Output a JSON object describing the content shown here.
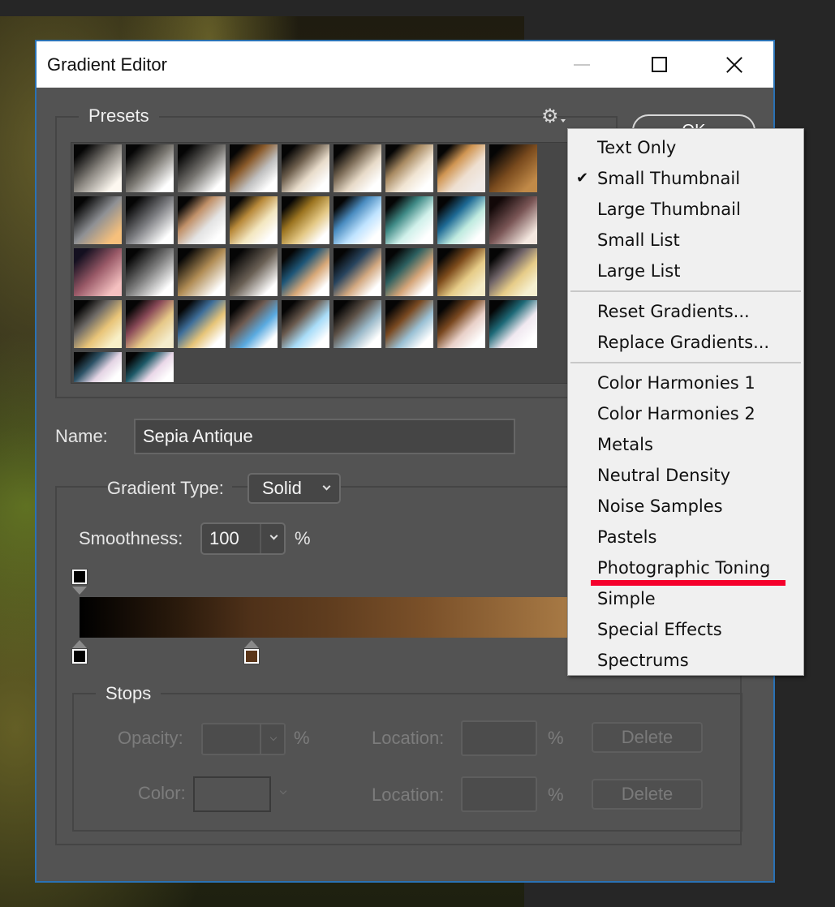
{
  "window": {
    "title": "Gradient Editor",
    "controls": {
      "minimize": "minimize",
      "maximize": "maximize",
      "close": "close"
    }
  },
  "presets": {
    "label": "Presets",
    "settings_icon": "gear-icon",
    "thumbnails": [
      {
        "name": "preset-1",
        "colors": [
          "#050505",
          "#8a8680",
          "#fdf8f0"
        ]
      },
      {
        "name": "preset-2",
        "colors": [
          "#050505",
          "#7d7a74",
          "#ffffff"
        ]
      },
      {
        "name": "preset-3",
        "colors": [
          "#050505",
          "#75736f",
          "#ffffff"
        ]
      },
      {
        "name": "preset-4",
        "colors": [
          "#050505",
          "#8a5a2a",
          "#bfbfbf",
          "#ffffff"
        ]
      },
      {
        "name": "preset-5",
        "colors": [
          "#050505",
          "#6e5f4d",
          "#e8dccb",
          "#ffffff"
        ]
      },
      {
        "name": "preset-6",
        "colors": [
          "#050505",
          "#7a6a55",
          "#e7dac8",
          "#ffffff"
        ]
      },
      {
        "name": "preset-7",
        "colors": [
          "#050505",
          "#a88a62",
          "#f0e4d2",
          "#ffffff"
        ]
      },
      {
        "name": "preset-8",
        "colors": [
          "#050505",
          "#d09552",
          "#eedfd0",
          "#f0ebe8"
        ]
      },
      {
        "name": "preset-9",
        "colors": [
          "#050505",
          "#7a4b1e",
          "#c18a48"
        ]
      },
      {
        "name": "preset-10",
        "colors": [
          "#050505",
          "#8e9094",
          "#f6c07c"
        ]
      },
      {
        "name": "preset-11",
        "colors": [
          "#050505",
          "#7b7c80",
          "#ffffff"
        ]
      },
      {
        "name": "preset-12",
        "colors": [
          "#050505",
          "#c09068",
          "#e3e3e3",
          "#ffffff"
        ]
      },
      {
        "name": "preset-13",
        "colors": [
          "#050505",
          "#b8893a",
          "#f3e6bf",
          "#ffffff"
        ]
      },
      {
        "name": "preset-14",
        "colors": [
          "#050505",
          "#9b7420",
          "#e3c784",
          "#ffffff"
        ]
      },
      {
        "name": "preset-15",
        "colors": [
          "#050505",
          "#4a8cc0",
          "#bfe3ff",
          "#ffffff"
        ]
      },
      {
        "name": "preset-16",
        "colors": [
          "#050505",
          "#3f8a86",
          "#d0f0ea",
          "#ffffff"
        ]
      },
      {
        "name": "preset-17",
        "colors": [
          "#050505",
          "#1e6a95",
          "#bfeadf",
          "#ffffff"
        ]
      },
      {
        "name": "preset-18",
        "colors": [
          "#120808",
          "#7a5656",
          "#f4e8e0"
        ]
      },
      {
        "name": "preset-19",
        "colors": [
          "#141020",
          "#9a5a68",
          "#f4c0c0"
        ]
      },
      {
        "name": "preset-20",
        "colors": [
          "#050505",
          "#7c7c7c",
          "#ffffff"
        ]
      },
      {
        "name": "preset-21",
        "colors": [
          "#050505",
          "#b08c55",
          "#ffffff"
        ]
      },
      {
        "name": "preset-22",
        "colors": [
          "#050505",
          "#6a6055",
          "#ffffff"
        ]
      },
      {
        "name": "preset-23",
        "colors": [
          "#050505",
          "#1e5678",
          "#d8a878",
          "#ffffff"
        ]
      },
      {
        "name": "preset-24",
        "colors": [
          "#050505",
          "#28445e",
          "#d2a880",
          "#ffffff"
        ]
      },
      {
        "name": "preset-25",
        "colors": [
          "#050505",
          "#2d6060",
          "#d4a478",
          "#ffffff"
        ]
      },
      {
        "name": "preset-26",
        "colors": [
          "#050505",
          "#7e4c1c",
          "#e6cc88",
          "#f4ecc8"
        ]
      },
      {
        "name": "preset-27",
        "colors": [
          "#050505",
          "#706468",
          "#e6cc88",
          "#f6f0d0"
        ]
      },
      {
        "name": "preset-28",
        "colors": [
          "#050505",
          "#6e6a66",
          "#e8c478",
          "#f8f0c8"
        ]
      },
      {
        "name": "preset-29",
        "colors": [
          "#050505",
          "#8a4a58",
          "#e6c888",
          "#f4eccc"
        ]
      },
      {
        "name": "preset-30",
        "colors": [
          "#050505",
          "#3e6e9a",
          "#e6c478",
          "#ffffff"
        ]
      },
      {
        "name": "preset-31",
        "colors": [
          "#050505",
          "#6e5a50",
          "#5aaae0",
          "#ffffff"
        ]
      },
      {
        "name": "preset-32",
        "colors": [
          "#050505",
          "#6a5a4e",
          "#a8dcf8",
          "#ffffff"
        ]
      },
      {
        "name": "preset-33",
        "colors": [
          "#050505",
          "#5c5046",
          "#9ab8c8",
          "#ffffff"
        ]
      },
      {
        "name": "preset-34",
        "colors": [
          "#050505",
          "#7a4a22",
          "#9ac0d4",
          "#ffffff"
        ]
      },
      {
        "name": "preset-35",
        "colors": [
          "#050505",
          "#7a4820",
          "#e8d0c8",
          "#ffffff"
        ]
      },
      {
        "name": "preset-36",
        "colors": [
          "#050505",
          "#1e6a78",
          "#f0e8f0",
          "#ffffff"
        ]
      },
      {
        "name": "preset-37",
        "colors": [
          "#050505",
          "#2e5468",
          "#e4d4e4",
          "#ffffff"
        ]
      },
      {
        "name": "preset-38",
        "colors": [
          "#050505",
          "#1e5a68",
          "#ead8e8",
          "#ffffff"
        ]
      }
    ]
  },
  "ok_button": "OK",
  "name_field": {
    "label": "Name:",
    "value": "Sepia Antique"
  },
  "gradient_type": {
    "label": "Gradient Type:",
    "value": "Solid"
  },
  "smoothness": {
    "label": "Smoothness:",
    "value": "100",
    "unit": "%"
  },
  "gradient_bar": {
    "opacity_stops": [
      {
        "location_pct": 0,
        "color": "#000000"
      }
    ],
    "color_stops": [
      {
        "location_pct": 0,
        "color": "#000000"
      },
      {
        "location_pct": 35,
        "color": "#5a3518"
      }
    ]
  },
  "stops": {
    "label": "Stops",
    "opacity_label": "Opacity:",
    "opacity_unit": "%",
    "color_label": "Color:",
    "location_label_1": "Location:",
    "location_label_2": "Location:",
    "location_unit": "%",
    "delete_1": "Delete",
    "delete_2": "Delete"
  },
  "context_menu": {
    "items": [
      {
        "label": "Text Only",
        "checked": false
      },
      {
        "label": "Small Thumbnail",
        "checked": true
      },
      {
        "label": "Large Thumbnail",
        "checked": false
      },
      {
        "label": "Small List",
        "checked": false
      },
      {
        "label": "Large List",
        "checked": false
      },
      {
        "separator": true
      },
      {
        "label": "Reset Gradients...",
        "checked": false
      },
      {
        "label": "Replace Gradients...",
        "checked": false
      },
      {
        "separator": true
      },
      {
        "label": "Color Harmonies 1",
        "checked": false
      },
      {
        "label": "Color Harmonies 2",
        "checked": false
      },
      {
        "label": "Metals",
        "checked": false
      },
      {
        "label": "Neutral Density",
        "checked": false
      },
      {
        "label": "Noise Samples",
        "checked": false
      },
      {
        "label": "Pastels",
        "checked": false
      },
      {
        "label": "Photographic Toning",
        "checked": false,
        "highlighted": true
      },
      {
        "label": "Simple",
        "checked": false
      },
      {
        "label": "Special Effects",
        "checked": false
      },
      {
        "label": "Spectrums",
        "checked": false
      }
    ],
    "check_glyph": "✔",
    "highlight_color": "#f5002c"
  }
}
